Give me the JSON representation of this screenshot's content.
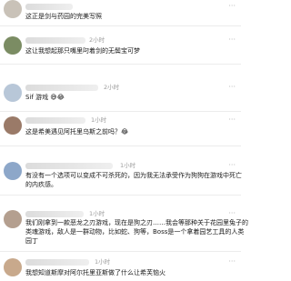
{
  "comments": [
    {
      "time": "",
      "text": "这正是剑与药园的完美写照",
      "avatar_color": "#c9c2b8"
    },
    {
      "time": "2小时",
      "text": "这让我想起那只嘴里叼着剑的无鬓宝可梦",
      "avatar_color": "#7b8c63"
    },
    {
      "time": "2小时",
      "text": "Sif 游戏 😅😂",
      "avatar_color": "#b8c7d8"
    },
    {
      "time": "1小时",
      "text": "这是希美遇见阿托里乌斯之前吗？😂",
      "avatar_color": "#9a7a68"
    },
    {
      "time": "1小时",
      "lines": [
        "有没有一个选项可以变成不可杀死的，因为我无法承受作为狗狗在游戏中死亡",
        "的内疚感。"
      ],
      "avatar_color": "#8da7c9"
    },
    {
      "time": "1小时",
      "lines": [
        "我们刚拿到一款恶龙之刃游戏，现在是狗之刃……我会等那种关于花园里兔子的",
        "类魂游戏，敌人是一群动物，比如蛇、狗等，Boss是一个拿着园艺工具的人类",
        "园丁"
      ],
      "avatar_color": "#b49f8f"
    },
    {
      "time": "1小时",
      "text": "我想知道斯摩对阿尔托里亚斯做了什么让希芙恼火",
      "avatar_color": "#c8a98c"
    }
  ],
  "icons": {
    "more": "more-dots-icon"
  }
}
